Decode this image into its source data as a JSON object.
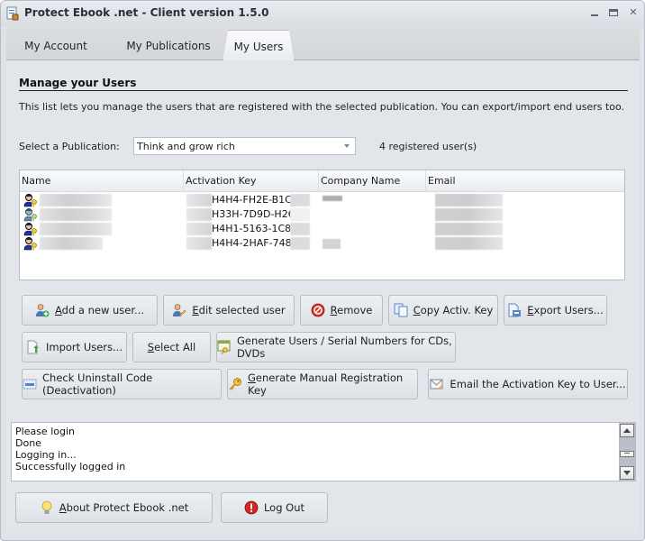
{
  "window": {
    "title": "Protect Ebook .net - Client version 1.5.0",
    "controls": {
      "minimize": "minimize",
      "maximize": "maximize",
      "close": "close"
    }
  },
  "tabs": [
    {
      "label": "My Account",
      "active": false
    },
    {
      "label": "My Publications",
      "active": false
    },
    {
      "label": "My Users",
      "active": true
    }
  ],
  "section": {
    "title": "Manage your Users",
    "description": "This list lets you manage the users that are registered with the selected publication. You can export/import end users too."
  },
  "publication": {
    "label": "Select a Publication:",
    "selected": "Think and grow rich",
    "count_text": "4 registered user(s)"
  },
  "users_table": {
    "columns": [
      "Name",
      "Activation Key",
      "Company Name",
      "Email"
    ],
    "rows": [
      {
        "icon": "user-key-icon",
        "name": "",
        "activation_key": "H4H4-FH2E-B1C8-",
        "company": "",
        "email": ""
      },
      {
        "icon": "user-key-disabled-icon",
        "name": "",
        "activation_key": "H33H-7D9D-H269-",
        "company": "",
        "email": ""
      },
      {
        "icon": "user-key-icon",
        "name": "",
        "activation_key": "H4H1-5163-1C87-",
        "company": "",
        "email": ""
      },
      {
        "icon": "user-key-icon",
        "name": "",
        "activation_key": "H4H4-2HAF-7485-",
        "company": "",
        "email": ""
      }
    ]
  },
  "buttons": {
    "add_user": {
      "prefix": "",
      "mnemonic": "A",
      "rest": "dd a new user..."
    },
    "edit_user": {
      "prefix": "",
      "mnemonic": "E",
      "rest": "dit selected user"
    },
    "remove": {
      "prefix": "",
      "mnemonic": "R",
      "rest": "emove"
    },
    "copy_key": {
      "prefix": "",
      "mnemonic": "C",
      "rest": "opy Activ. Key"
    },
    "export_users": {
      "prefix": "",
      "mnemonic": "E",
      "rest": "xport Users..."
    },
    "import_users": {
      "label": "Import Users..."
    },
    "select_all": {
      "prefix": "",
      "mnemonic": "S",
      "rest": "elect All"
    },
    "generate_serials": {
      "label": "Generate Users / Serial Numbers for CDs, DVDs"
    },
    "check_uninstall": {
      "label": "Check Uninstall Code (Deactivation)"
    },
    "manual_key": {
      "prefix": "",
      "mnemonic": "G",
      "rest": "enerate Manual Registration Key"
    },
    "email_key": {
      "label": "Email the Activation Key to User..."
    },
    "about": {
      "prefix": "",
      "mnemonic": "A",
      "rest": "bout Protect Ebook .net"
    },
    "logout": {
      "label": "Log Out"
    }
  },
  "log": {
    "lines": [
      "Please login",
      "Done",
      "Logging in...",
      "Successfully logged in"
    ]
  },
  "colors": {
    "window_bg": "#dfe3e8",
    "panel_bg": "#e2e6ea",
    "button_border": "#b7bec8",
    "remove_red": "#d9342a"
  }
}
